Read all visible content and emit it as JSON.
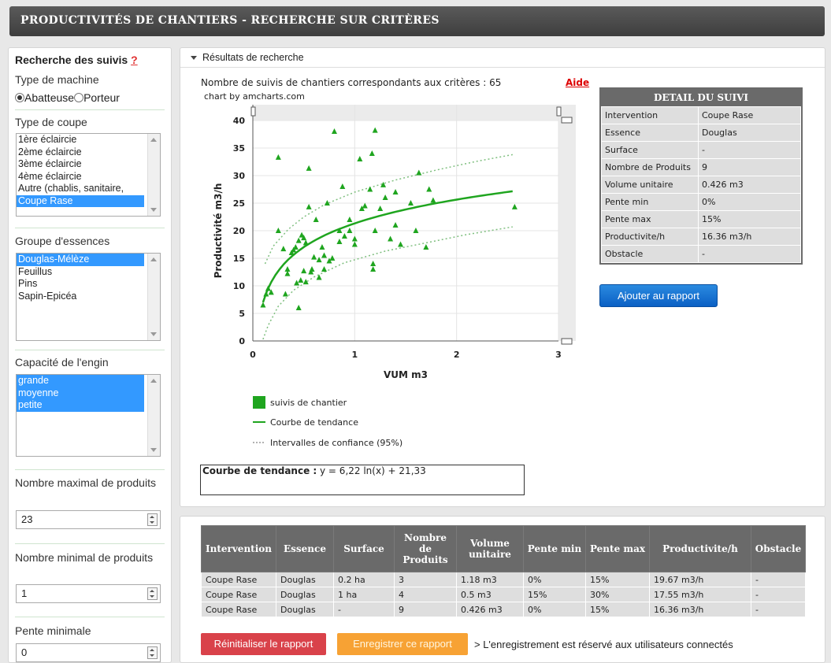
{
  "header": {
    "title": "PRODUCTIVITÉS DE CHANTIERS - RECHERCHE SUR CRITÈRES"
  },
  "sidebar": {
    "title": "Recherche des suivis",
    "help": "?",
    "machine_label": "Type de machine",
    "machine_options": [
      "Abatteuse",
      "Porteur"
    ],
    "machine_selected": "Abatteuse",
    "coupe_label": "Type de coupe",
    "coupe_options": [
      "1ère éclaircie",
      "2ème éclaircie",
      "3ème éclaircie",
      "4ème éclaircie",
      "Autre (chablis, sanitaire,",
      "Coupe Rase"
    ],
    "coupe_selected": [
      5
    ],
    "essences_label": "Groupe d'essences",
    "essences_options": [
      "Douglas-Mélèze",
      "Feuillus",
      "Pins",
      "Sapin-Epicéa"
    ],
    "essences_selected": [
      0
    ],
    "capacite_label": "Capacité de l'engin",
    "capacite_options": [
      "grande",
      "moyenne",
      "petite"
    ],
    "capacite_selected": [
      0,
      1,
      2
    ],
    "max_produits_label": "Nombre maximal de produits",
    "max_produits_value": "23",
    "min_produits_label": "Nombre minimal de produits",
    "min_produits_value": "1",
    "pente_min_label": "Pente minimale",
    "pente_min_value": "0"
  },
  "results": {
    "section_title": "Résultats de recherche",
    "count_text": "Nombre de suivis de chantiers correspondants aux critères : 65",
    "aide": "Aide",
    "credit": "chart by amcharts.com",
    "formula_label": "Courbe de tendance :",
    "formula": " y = 6,22 ln(x) + 21,33",
    "add_button": "Ajouter au rapport"
  },
  "detail": {
    "title": "DETAIL DU SUIVI",
    "rows": [
      {
        "k": "Intervention",
        "v": "Coupe Rase"
      },
      {
        "k": "Essence",
        "v": "Douglas"
      },
      {
        "k": "Surface",
        "v": "-"
      },
      {
        "k": "Nombre de Produits",
        "v": "9"
      },
      {
        "k": "Volume unitaire",
        "v": "0.426 m3"
      },
      {
        "k": "Pente min",
        "v": "0%"
      },
      {
        "k": "Pente max",
        "v": "15%"
      },
      {
        "k": "Productivite/h",
        "v": "16.36 m3/h"
      },
      {
        "k": "Obstacle",
        "v": "-"
      }
    ]
  },
  "report": {
    "headers": [
      "Intervention",
      "Essence",
      "Surface",
      "Nombre de Produits",
      "Volume unitaire",
      "Pente min",
      "Pente max",
      "Productivite/h",
      "Obstacle"
    ],
    "rows": [
      [
        "Coupe Rase",
        "Douglas",
        "0.2 ha",
        "3",
        "1.18 m3",
        "0%",
        "15%",
        "19.67 m3/h",
        "-"
      ],
      [
        "Coupe Rase",
        "Douglas",
        "1 ha",
        "4",
        "0.5 m3",
        "15%",
        "30%",
        "17.55 m3/h",
        "-"
      ],
      [
        "Coupe Rase",
        "Douglas",
        "-",
        "9",
        "0.426 m3",
        "0%",
        "15%",
        "16.36 m3/h",
        "-"
      ]
    ],
    "reset_button": "Réinitialiser le rapport",
    "save_button": "Enregistrer ce rapport",
    "note": "> L'enregistrement est réservé aux utilisateurs connectés"
  },
  "chart_data": {
    "type": "scatter",
    "xlabel": "VUM m3",
    "ylabel": "Productivité m3/h",
    "xlim": [
      0,
      3
    ],
    "ylim": [
      0,
      40
    ],
    "xticks": [
      0,
      1,
      2,
      3
    ],
    "yticks": [
      0,
      5,
      10,
      15,
      20,
      25,
      30,
      35,
      40
    ],
    "grid": true,
    "legend_position": "bottom",
    "legend": [
      "suivis de chantier",
      "Courbe de tendance",
      "Intervalles de confiance (95%)"
    ],
    "colors": {
      "points": "#1fa51f",
      "trend": "#1fa51f",
      "ci": "#7fbf7f"
    },
    "trend": {
      "a": 6.22,
      "b": 21.33,
      "x_range": [
        0.1,
        2.55
      ]
    },
    "ci_upper": [
      [
        0.12,
        14
      ],
      [
        0.2,
        17.2
      ],
      [
        0.35,
        20.3
      ],
      [
        0.5,
        22.5
      ],
      [
        0.7,
        24.7
      ],
      [
        1.0,
        27
      ],
      [
        1.4,
        29.2
      ],
      [
        1.8,
        31
      ],
      [
        2.2,
        32.6
      ],
      [
        2.55,
        33.8
      ]
    ],
    "ci_lower": [
      [
        0.1,
        0.3
      ],
      [
        0.15,
        2.8
      ],
      [
        0.25,
        6.3
      ],
      [
        0.4,
        9.2
      ],
      [
        0.6,
        11.6
      ],
      [
        0.9,
        14.2
      ],
      [
        1.3,
        16.3
      ],
      [
        1.7,
        17.8
      ],
      [
        2.1,
        19.3
      ],
      [
        2.55,
        20.7
      ]
    ],
    "points": [
      [
        0.1,
        6.5
      ],
      [
        0.13,
        8.5
      ],
      [
        0.15,
        9.5
      ],
      [
        0.18,
        8.8
      ],
      [
        0.25,
        20
      ],
      [
        0.3,
        16.7
      ],
      [
        0.32,
        8.5
      ],
      [
        0.34,
        13
      ],
      [
        0.34,
        12.2
      ],
      [
        0.38,
        16
      ],
      [
        0.4,
        16.5
      ],
      [
        0.42,
        17
      ],
      [
        0.43,
        10.5
      ],
      [
        0.45,
        6
      ],
      [
        0.45,
        18.2
      ],
      [
        0.47,
        11
      ],
      [
        0.48,
        19.2
      ],
      [
        0.5,
        18.7
      ],
      [
        0.5,
        12.7
      ],
      [
        0.52,
        17.8
      ],
      [
        0.52,
        10.7
      ],
      [
        0.55,
        24.3
      ],
      [
        0.55,
        31.3
      ],
      [
        0.57,
        12.5
      ],
      [
        0.58,
        13
      ],
      [
        0.6,
        15.2
      ],
      [
        0.62,
        22
      ],
      [
        0.65,
        14.7
      ],
      [
        0.65,
        11.5
      ],
      [
        0.68,
        17
      ],
      [
        0.7,
        13
      ],
      [
        0.7,
        15.5
      ],
      [
        0.73,
        25
      ],
      [
        0.75,
        14.5
      ],
      [
        0.78,
        15
      ],
      [
        0.8,
        38
      ],
      [
        0.85,
        18
      ],
      [
        0.85,
        20
      ],
      [
        0.88,
        28
      ],
      [
        0.9,
        19
      ],
      [
        0.95,
        22
      ],
      [
        0.95,
        20
      ],
      [
        1.0,
        17.5
      ],
      [
        1.0,
        18.5
      ],
      [
        1.05,
        33
      ],
      [
        1.07,
        24
      ],
      [
        1.1,
        24.5
      ],
      [
        1.15,
        27.5
      ],
      [
        1.17,
        34
      ],
      [
        1.18,
        13
      ],
      [
        1.18,
        14
      ],
      [
        1.2,
        38.2
      ],
      [
        1.2,
        20
      ],
      [
        1.25,
        24
      ],
      [
        1.28,
        28.3
      ],
      [
        1.3,
        26
      ],
      [
        1.35,
        18.5
      ],
      [
        1.4,
        21
      ],
      [
        1.4,
        27
      ],
      [
        1.45,
        17.5
      ],
      [
        1.55,
        25
      ],
      [
        1.6,
        20
      ],
      [
        1.63,
        30.5
      ],
      [
        1.7,
        17
      ],
      [
        1.73,
        27.5
      ],
      [
        1.77,
        25.5
      ],
      [
        2.57,
        24.3
      ],
      [
        0.25,
        33.3
      ]
    ]
  }
}
